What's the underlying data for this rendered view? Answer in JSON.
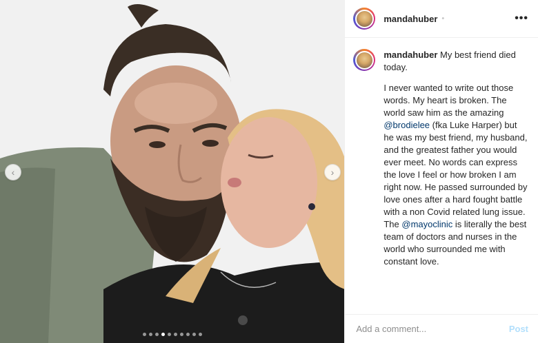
{
  "post": {
    "username": "mandahuber",
    "header_dot": "•",
    "more_label": "•••",
    "caption": {
      "first_line": "My best friend died today.",
      "body_parts": [
        {
          "text": "I never wanted to write out those words. My heart is broken. The world saw him as the amazing "
        },
        {
          "mention": "@brodielee"
        },
        {
          "text": " (fka Luke Harper) but he was my best friend, my husband, and the greatest father you would ever meet. No words can express the love I feel or how broken I am right now. He passed surrounded by love ones after a hard fought battle with a non Covid related lung issue. The "
        },
        {
          "mention": "@mayoclinic"
        },
        {
          "text": " is literally the best team of doctors and nurses in the world who surrounded me with constant love."
        }
      ]
    }
  },
  "carousel": {
    "prev_icon": "chevron-left-icon",
    "next_icon": "chevron-right-icon",
    "prev_glyph": "‹",
    "next_glyph": "›",
    "dot_count": 10,
    "active_dot": 3
  },
  "comment": {
    "placeholder": "Add a comment...",
    "post_label": "Post"
  },
  "colors": {
    "mention": "#00376b",
    "post_disabled": "#b2dffc",
    "border": "#efefef"
  }
}
